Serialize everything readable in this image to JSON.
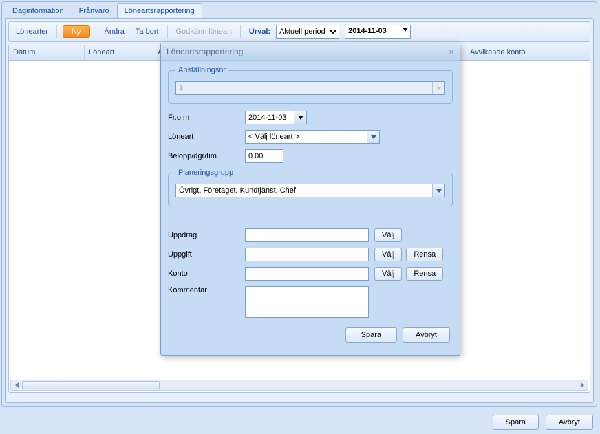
{
  "tabs": {
    "daginformation": "Daginformation",
    "franvaro": "Frånvaro",
    "loneartsrapportering": "Löneartsrapportering"
  },
  "toolbar": {
    "lonearter": "Lönearter",
    "ny": "Ny",
    "andra": "Ändra",
    "tabort": "Ta bort",
    "godkann": "Godkänn löneart",
    "urval_label": "Urval:",
    "urval_value": "Aktuell period",
    "date_value": "2014-11-03"
  },
  "grid": {
    "cols": {
      "datum": "Datum",
      "loneart": "Löneart",
      "antal": "Anta",
      "avvikande": "Avvikande konto"
    }
  },
  "dialog": {
    "title": "Löneartsrapportering",
    "anstallningsnr_legend": "Anställningsnr",
    "anstallningsnr_value": "1",
    "from_label": "Fr.o.m",
    "from_value": "2014-11-03",
    "loneart_label": "Löneart",
    "loneart_value": "< Välj löneart >",
    "belopp_label": "Belopp/dgr/tim",
    "belopp_value": "0.00",
    "planeringsgrupp_legend": "Planeringsgrupp",
    "planeringsgrupp_value": "Övrigt, Företaget, Kundtjänst, Chef",
    "uppdrag_label": "Uppdrag",
    "uppgift_label": "Uppgift",
    "konto_label": "Konto",
    "kommentar_label": "Kommentar",
    "valj": "Välj",
    "rensa": "Rensa",
    "spara": "Spara",
    "avbryt": "Avbryt"
  },
  "footer": {
    "spara": "Spara",
    "avbryt": "Avbryt"
  }
}
